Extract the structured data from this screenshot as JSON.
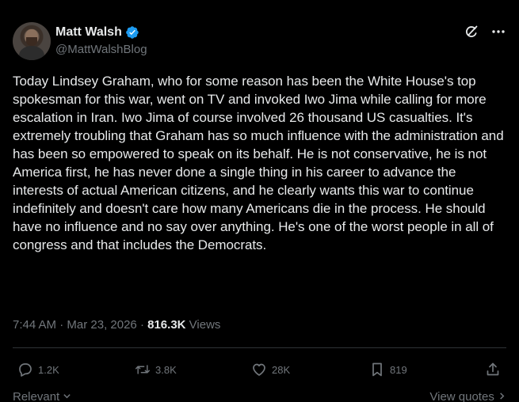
{
  "author": {
    "name": "Matt Walsh",
    "handle": "@MattWalshBlog"
  },
  "tweet": {
    "text": "Today Lindsey Graham, who for some reason has been the White House's top spokesman for this war, went on TV and invoked Iwo Jima while calling for more escalation in Iran. Iwo Jima of course involved 26 thousand US casualties. It's extremely troubling that Graham has so much influence with the administration and has been so empowered to speak on its behalf. He is not conservative, he is not America first, he has never done a single thing in his career to advance the interests of actual American citizens, and he clearly wants this war to continue indefinitely and doesn't care how many Americans die in the process. He should have no influence and no say over anything. He's one of the worst people in all of congress and that includes the Democrats.",
    "time": "7:44 AM",
    "separator": "·",
    "date": "Mar 23, 2026",
    "views_count": "816.3K",
    "views_label": "Views"
  },
  "actions": {
    "replies": "1.2K",
    "reposts": "3.8K",
    "likes": "28K",
    "bookmarks": "819"
  },
  "footer": {
    "relevant": "Relevant",
    "view_quotes": "View quotes"
  },
  "colors": {
    "background": "#000000",
    "text": "#e7e9ea",
    "secondary": "#71767b",
    "verified": "#1d9bf0",
    "divider": "#2f3336"
  },
  "icons": [
    "verified-badge-icon",
    "grok-icon",
    "more-icon",
    "reply-icon",
    "repost-icon",
    "like-icon",
    "bookmark-icon",
    "share-icon",
    "chevron-down-icon",
    "chevron-right-icon"
  ]
}
